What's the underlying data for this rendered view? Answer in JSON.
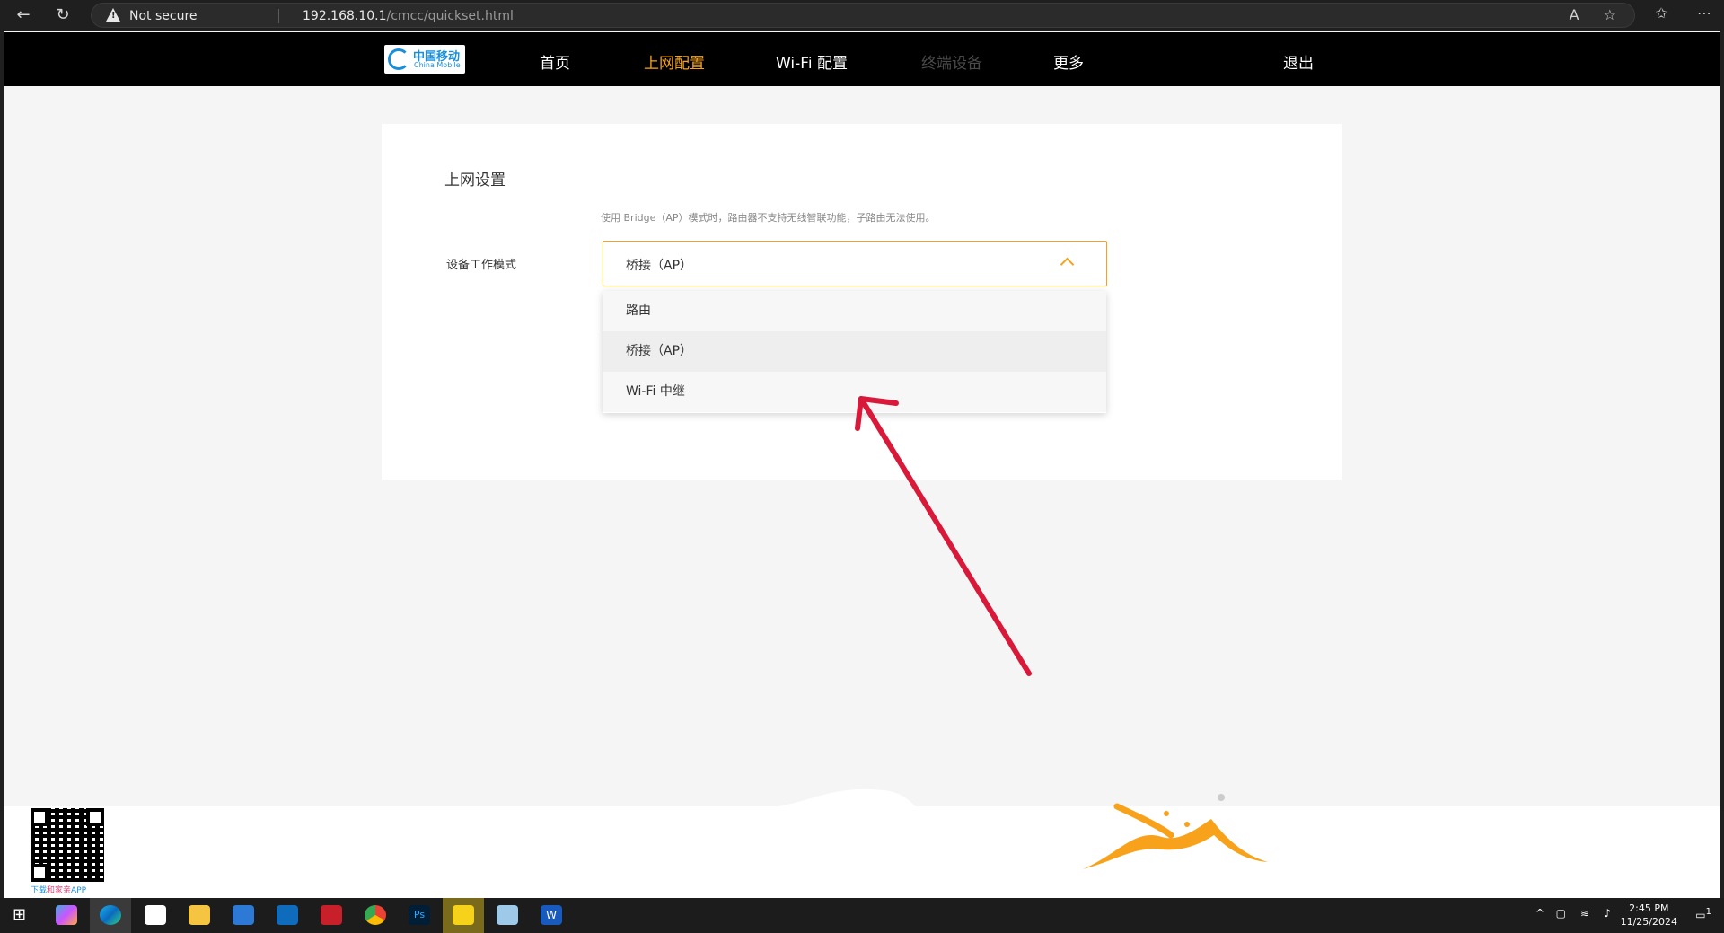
{
  "browser": {
    "security_label": "Not secure",
    "url_host": "192.168.10.1",
    "url_path": "/cmcc/quickset.html"
  },
  "logo": {
    "cn": "中国移动",
    "en": "China Mobile"
  },
  "nav": {
    "home": "首页",
    "internet": "上网配置",
    "wifi": "Wi-Fi 配置",
    "devices": "终端设备",
    "more": "更多",
    "logout": "退出"
  },
  "settings": {
    "title": "上网设置",
    "hint": "使用 Bridge（AP）模式时，路由器不支持无线智联功能，子路由无法使用。",
    "mode_label": "设备工作模式",
    "mode_value": "桥接（AP）",
    "options": [
      "路由",
      "桥接（AP）",
      "Wi-Fi 中继"
    ]
  },
  "footer": {
    "qr_caption_prefix": "下载",
    "qr_caption_brand": "和家亲",
    "qr_caption_suffix": "APP"
  },
  "taskbar": {
    "time": "2:45 PM",
    "date": "11/25/2024",
    "notification_count": "1"
  },
  "colors": {
    "accent": "#f8a21c",
    "annotation": "#d8193a",
    "nav_bg": "#000000"
  }
}
